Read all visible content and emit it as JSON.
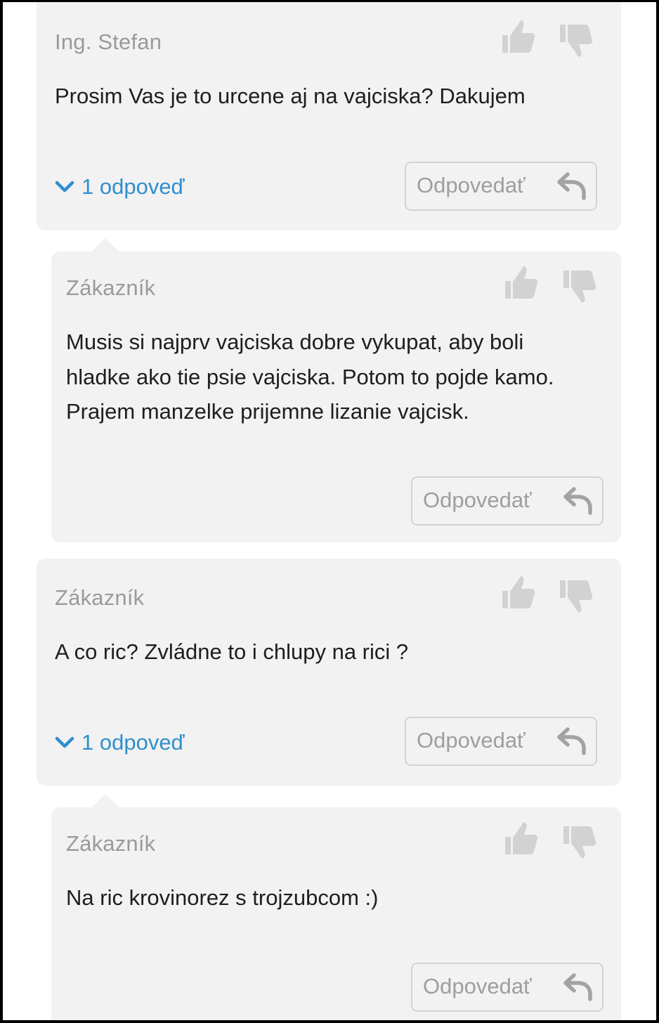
{
  "comments": [
    {
      "author": "Ing. Stefan",
      "text": "Prosim Vas je to urcene aj na vajciska? Dakujem",
      "replies_label": "1 odpoveď",
      "reply_label": "Odpovedať"
    },
    {
      "author": "Zákazník",
      "text_lines": [
        "Musis si najprv vajciska dobre vykupat, aby boli",
        "hladke ako tie psie vajciska. Potom to pojde kamo.",
        "Prajem manzelke prijemne lizanie vajcisk."
      ],
      "reply_label": "Odpovedať"
    },
    {
      "author": "Zákazník",
      "text": "A co ric? Zvládne to i chlupy na rici ?",
      "replies_label": "1 odpoveď",
      "reply_label": "Odpovedať"
    },
    {
      "author": "Zákazník",
      "text": "Na ric krovinorez s trojzubcom :)",
      "reply_label": "Odpovedať"
    }
  ],
  "icons": {
    "like": "thumbs-up-icon",
    "dislike": "thumbs-down-icon",
    "reply": "reply-arrow-icon",
    "expand": "chevron-down-icon"
  },
  "colors": {
    "card_background": "#f2f2f2",
    "author": "#9a9a9a",
    "text": "#1e1e1e",
    "link": "#2f8fcc",
    "icon": "#d2d2d2",
    "button_border": "#d3d3d3",
    "button_text": "#9e9e9e"
  }
}
